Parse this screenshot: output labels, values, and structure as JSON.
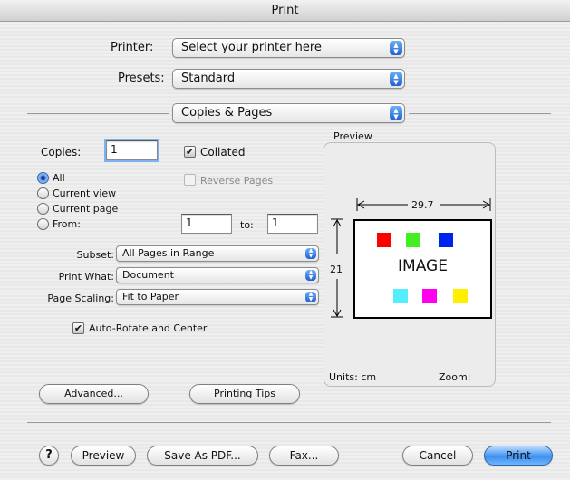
{
  "window": {
    "title": "Print"
  },
  "top": {
    "printer_label": "Printer:",
    "printer_value": "Select your printer here",
    "presets_label": "Presets:",
    "presets_value": "Standard",
    "pane_value": "Copies & Pages"
  },
  "copies": {
    "label": "Copies:",
    "value": "1",
    "collated_label": "Collated",
    "collated_checked": true,
    "reverse_label": "Reverse Pages",
    "reverse_checked": false
  },
  "pages": {
    "options": [
      "All",
      "Current view",
      "Current page",
      "From:"
    ],
    "selected": "All",
    "from_value": "1",
    "to_label": "to:",
    "to_value": "1"
  },
  "selects": {
    "subset_label": "Subset:",
    "subset_value": "All Pages in Range",
    "print_what_label": "Print What:",
    "print_what_value": "Document",
    "scaling_label": "Page Scaling:",
    "scaling_value": "Fit to Paper"
  },
  "auto_rotate": {
    "label": "Auto-Rotate and Center",
    "checked": true
  },
  "preview": {
    "title": "Preview",
    "width_label": "29.7",
    "height_label": "21",
    "image_text": "IMAGE",
    "units_label": "Units: cm",
    "zoom_label": "Zoom:",
    "swatch_colors": [
      "#ff0000",
      "#44ee22",
      "#0022ee",
      "#55eeff",
      "#ff00ee",
      "#ffee00"
    ]
  },
  "buttons": {
    "advanced": "Advanced...",
    "printing_tips": "Printing Tips",
    "help": "?",
    "preview": "Preview",
    "save_pdf": "Save As PDF...",
    "fax": "Fax...",
    "cancel": "Cancel",
    "print": "Print"
  },
  "icons": {
    "popup_arrows": "up-down-arrows-icon",
    "check": "checkmark-icon"
  }
}
